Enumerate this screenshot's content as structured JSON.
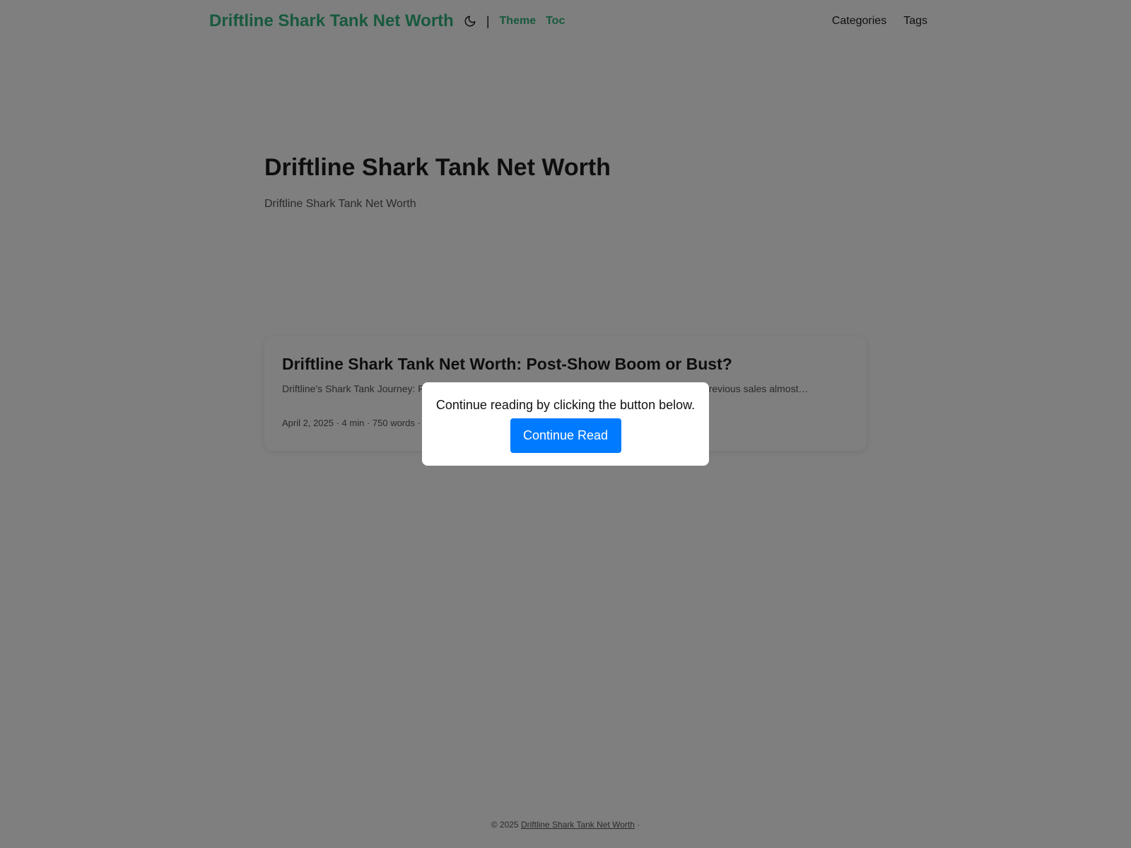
{
  "header": {
    "logo": "Driftline Shark Tank Net Worth",
    "theme_toggle_icon": "moon-icon",
    "separator": "|",
    "links": [
      "Theme",
      "Toc"
    ],
    "nav": [
      "Categories",
      "Tags"
    ]
  },
  "hero": {
    "title": "Driftline Shark Tank Net Worth",
    "subtitle": "Driftline Shark Tank Net Worth"
  },
  "post": {
    "title": "Driftline Shark Tank Net Worth: Post-Show Boom or Bust?",
    "summary": "Driftline's Shark Tank Journey: F… rd shorts company, experienced a dramatic surge in… ing of previous sales almost…",
    "meta": "April 2, 2025 · 4 min · 750 words · D"
  },
  "footer": {
    "copyright": "© 2025",
    "site_link": "Driftline Shark Tank Net Worth",
    "suffix": "·"
  },
  "modal": {
    "message": "Continue reading by clicking the button below.",
    "button_label": "Continue Read"
  },
  "colors": {
    "accent_green": "#30b27a",
    "button_blue": "#007bff",
    "overlay": "rgba(0,0,0,0.5)"
  }
}
